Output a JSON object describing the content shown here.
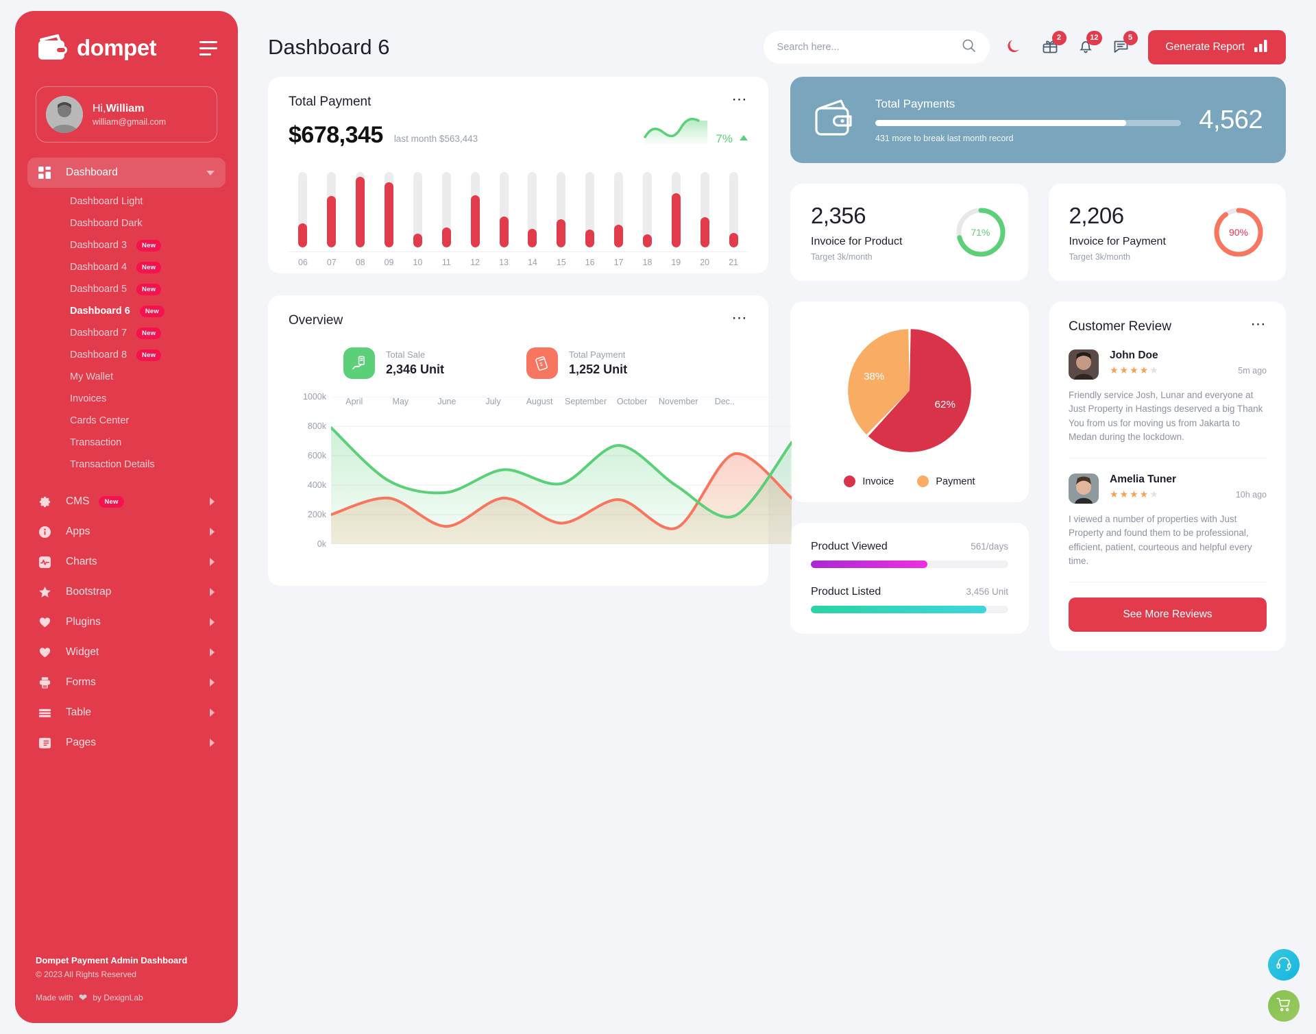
{
  "brand": {
    "name": "dompet",
    "logo_icon": "wallet-icon",
    "menu_icon": "hamburger-icon"
  },
  "profile": {
    "greeting_prefix": "Hi,",
    "name": "William",
    "email": "william@gmail.com",
    "avatar_alt": "user-avatar"
  },
  "sidebar": {
    "dashboard": {
      "label": "Dashboard",
      "icon": "grid-icon",
      "children": [
        {
          "label": "Dashboard Light",
          "badge": ""
        },
        {
          "label": "Dashboard Dark",
          "badge": ""
        },
        {
          "label": "Dashboard 3",
          "badge": "New"
        },
        {
          "label": "Dashboard 4",
          "badge": "New"
        },
        {
          "label": "Dashboard 5",
          "badge": "New"
        },
        {
          "label": "Dashboard 6",
          "badge": "New"
        },
        {
          "label": "Dashboard 7",
          "badge": "New"
        },
        {
          "label": "Dashboard 8",
          "badge": "New"
        },
        {
          "label": "My Wallet",
          "badge": ""
        },
        {
          "label": "Invoices",
          "badge": ""
        },
        {
          "label": "Cards Center",
          "badge": ""
        },
        {
          "label": "Transaction",
          "badge": ""
        },
        {
          "label": "Transaction Details",
          "badge": ""
        }
      ]
    },
    "items": [
      {
        "label": "CMS",
        "icon": "gear-icon",
        "badge": "New"
      },
      {
        "label": "Apps",
        "icon": "info-icon",
        "badge": ""
      },
      {
        "label": "Charts",
        "icon": "pulse-icon",
        "badge": ""
      },
      {
        "label": "Bootstrap",
        "icon": "star-icon",
        "badge": ""
      },
      {
        "label": "Plugins",
        "icon": "heart-icon",
        "badge": ""
      },
      {
        "label": "Widget",
        "icon": "heart-icon",
        "badge": ""
      },
      {
        "label": "Forms",
        "icon": "printer-icon",
        "badge": ""
      },
      {
        "label": "Table",
        "icon": "table-icon",
        "badge": ""
      },
      {
        "label": "Pages",
        "icon": "pages-icon",
        "badge": ""
      }
    ],
    "footer": {
      "title": "Dompet Payment Admin Dashboard",
      "copyright": "© 2023 All Rights Reserved",
      "made_prefix": "Made with",
      "made_suffix": "by DexignLab",
      "heart_icon": "heart-icon"
    }
  },
  "header": {
    "title": "Dashboard 6",
    "search": {
      "placeholder": "Search here...",
      "value": "",
      "icon": "search-icon"
    },
    "theme_toggle_icon": "moon-icon",
    "icons": [
      {
        "name": "gift-icon",
        "badge": "2"
      },
      {
        "name": "bell-icon",
        "badge": "12"
      },
      {
        "name": "message-icon",
        "badge": "5"
      }
    ],
    "generate_report": {
      "label": "Generate Report",
      "icon": "bar-chart-icon"
    }
  },
  "total_payment": {
    "title": "Total Payment",
    "amount": "$678,345",
    "last_month": "last month $563,443",
    "percent": "7%",
    "trend": "up",
    "menu_icon": "ellipsis-icon"
  },
  "total_payments_banner": {
    "title": "Total Payments",
    "value": "4,562",
    "note": "431 more to break last month record",
    "progress_percent": 82,
    "icon": "wallet-icon",
    "bg_color": "#7aa6bd"
  },
  "invoice_cards": [
    {
      "value": "2,356",
      "label": "Invoice for Product",
      "target": "Target 3k/month",
      "percent": "71%",
      "percent_num": 71,
      "color": "#5bd078"
    },
    {
      "value": "2,206",
      "label": "Invoice for Payment",
      "target": "Target 3k/month",
      "percent": "90%",
      "percent_num": 90,
      "color": "#f8755f"
    }
  ],
  "overview": {
    "title": "Overview",
    "menu_icon": "ellipsis-icon",
    "stats": [
      {
        "label": "Total Sale",
        "value": "2,346 Unit",
        "icon": "hand-money-icon",
        "color": "#5bd078"
      },
      {
        "label": "Total Payment",
        "value": "1,252 Unit",
        "icon": "card-terminal-icon",
        "color": "#f8755f"
      }
    ]
  },
  "product_progress": [
    {
      "label": "Product Viewed",
      "value": "561/days",
      "percent": 59,
      "color_from": "#a92ad1",
      "color_to": "#ee2fe0"
    },
    {
      "label": "Product Listed",
      "value": "3,456 Unit",
      "percent": 89,
      "color_from": "#2bd4a0",
      "color_to": "#3ad6e0"
    }
  ],
  "customer_review": {
    "title": "Customer Review",
    "menu_icon": "ellipsis-icon",
    "reviews": [
      {
        "name": "John Doe",
        "stars": 4,
        "max_stars": 5,
        "time": "5m ago",
        "text": "Friendly service Josh, Lunar and everyone at Just Property in Hastings deserved a big Thank You from us for moving us from Jakarta to Medan during the lockdown."
      },
      {
        "name": "Amelia Tuner",
        "stars": 4,
        "max_stars": 5,
        "time": "10h ago",
        "text": "I viewed a number of properties with Just Property and found them to be professional, efficient, patient, courteous and helpful every time."
      }
    ],
    "see_more_label": "See More Reviews"
  },
  "floating_buttons": [
    {
      "name": "support-headset-icon"
    },
    {
      "name": "shopping-cart-icon"
    }
  ],
  "chart_data": [
    {
      "type": "bar",
      "title": "Total Payment",
      "categories": [
        "06",
        "07",
        "08",
        "09",
        "10",
        "11",
        "12",
        "13",
        "14",
        "15",
        "16",
        "17",
        "18",
        "19",
        "20",
        "21"
      ],
      "values": [
        32,
        68,
        94,
        86,
        18,
        26,
        69,
        41,
        25,
        37,
        24,
        30,
        17,
        72,
        40,
        19
      ],
      "ylim": [
        0,
        100
      ],
      "xlabel": "",
      "ylabel": "",
      "grid": false,
      "bar_color": "#e13b4c",
      "track_color": "#ececec"
    },
    {
      "type": "area",
      "title": "Overview",
      "x": [
        "April",
        "May",
        "June",
        "July",
        "August",
        "September",
        "October",
        "November",
        "Dec.."
      ],
      "series": [
        {
          "name": "Total Sale",
          "color": "#5bd078",
          "values": [
            790,
            430,
            350,
            505,
            410,
            670,
            395,
            190,
            690
          ]
        },
        {
          "name": "Total Payment",
          "color": "#f8755f",
          "values": [
            200,
            312,
            120,
            312,
            142,
            302,
            110,
            612,
            312
          ]
        }
      ],
      "ylim": [
        0,
        1000000
      ],
      "ytick_labels": [
        "0k",
        "200k",
        "400k",
        "600k",
        "800k",
        "1000k"
      ],
      "xlabel": "",
      "ylabel": "",
      "grid": true,
      "legend": "none"
    },
    {
      "type": "pie",
      "title": "",
      "labels": [
        "Invoice",
        "Payment"
      ],
      "values": [
        62,
        38
      ],
      "value_labels": [
        "62%",
        "38%"
      ],
      "colors": [
        "#d9334a",
        "#f9ac63"
      ],
      "legend": "bottom"
    }
  ]
}
